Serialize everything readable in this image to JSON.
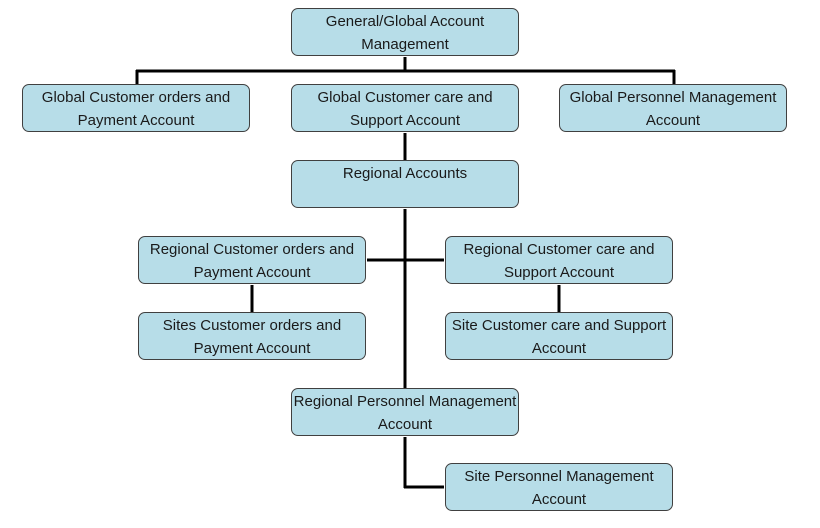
{
  "colors": {
    "box_fill": "#b7dde8",
    "box_border": "#404040",
    "connector": "#000000"
  },
  "nodes": {
    "general": "General/Global Account Management",
    "global_orders": "Global Customer orders and Payment Account",
    "global_care": "Global Customer care and Support Account",
    "global_personnel": "Global Personnel Management Account",
    "regional": "Regional Accounts",
    "regional_orders": "Regional Customer orders and Payment Account",
    "regional_care": "Regional Customer care and Support Account",
    "sites_orders": "Sites Customer orders and Payment Account",
    "site_care": "Site Customer care and Support Account",
    "regional_personnel": "Regional Personnel Management Account",
    "site_personnel": "Site Personnel Management Account"
  }
}
